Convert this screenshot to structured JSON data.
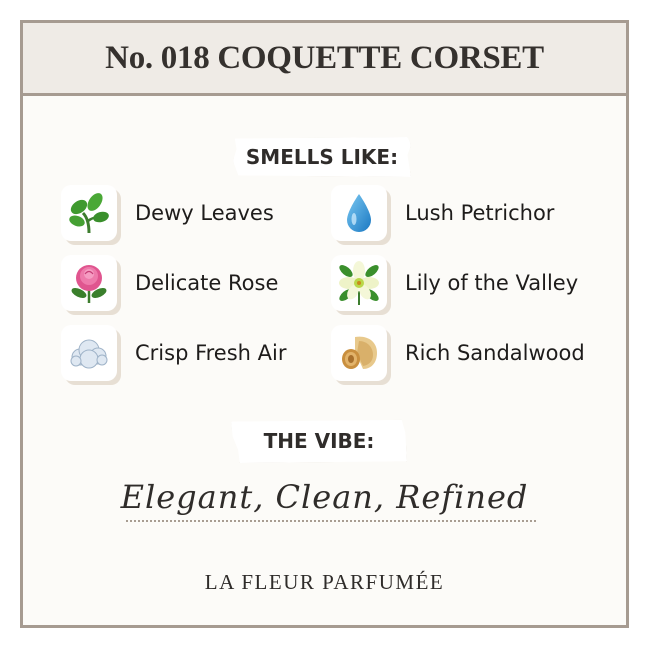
{
  "header": {
    "title": "No. 018 COQUETTE CORSET"
  },
  "smells_like": {
    "label": "SMELLS LIKE:",
    "notes": [
      {
        "label": "Dewy Leaves",
        "icon": "leaves-icon"
      },
      {
        "label": "Lush Petrichor",
        "icon": "water-drop-icon"
      },
      {
        "label": "Delicate Rose",
        "icon": "rose-icon"
      },
      {
        "label": "Lily of the Valley",
        "icon": "lily-flower-icon"
      },
      {
        "label": "Crisp Fresh Air",
        "icon": "cloud-icon"
      },
      {
        "label": "Rich Sandalwood",
        "icon": "wood-shavings-icon"
      }
    ]
  },
  "vibe": {
    "label": "THE VIBE:",
    "text": "Elegant, Clean, Refined"
  },
  "brand": {
    "name": "LA FLEUR PARFUMÉE"
  },
  "colors": {
    "frame": "#a69b91",
    "header_bg": "#efebe6",
    "card_bg": "#fcfbf8",
    "text": "#35312e"
  }
}
